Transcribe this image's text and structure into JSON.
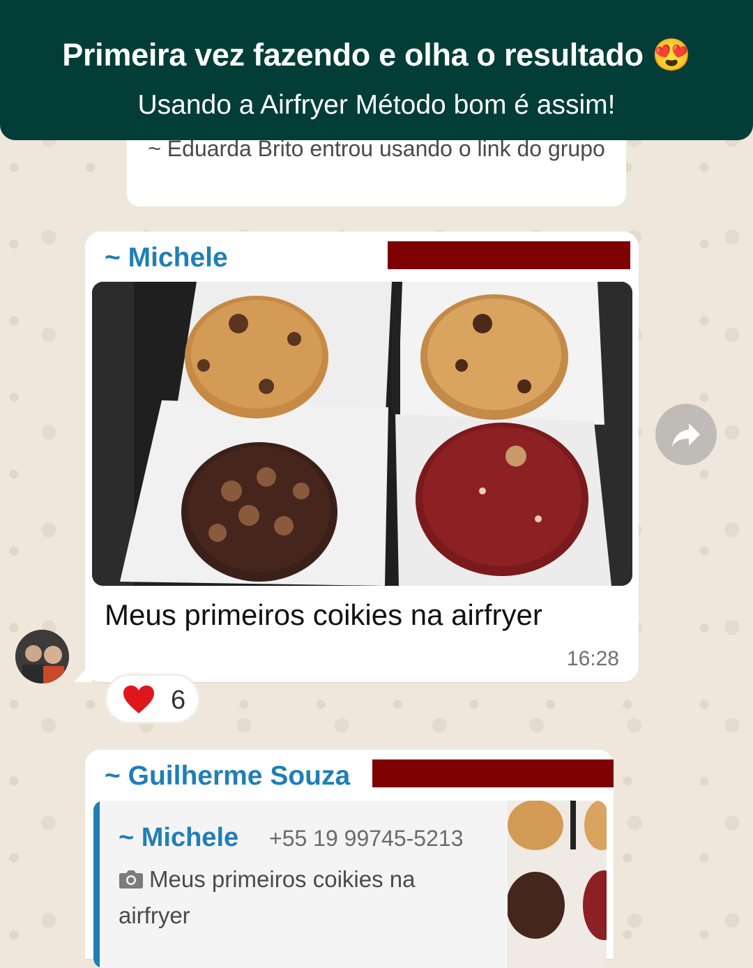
{
  "banner": {
    "title": "Primeira vez fazendo e olha o resultado 😍",
    "subtitle": "Usando a Airfryer Método bom é assim!"
  },
  "system_message": "~ Eduarda Brito entrou usando o link do grupo",
  "message1": {
    "sender": "~ Michele",
    "caption": "Meus primeiros coikies na airfryer",
    "time": "16:28",
    "reaction_emoji": "❤️",
    "reaction_count": "6"
  },
  "message2": {
    "sender": "~ Guilherme Souza",
    "quoted": {
      "sender": "~ Michele",
      "phone": "+55 19 99745-5213",
      "text": "Meus primeiros coikies na airfryer"
    }
  },
  "colors": {
    "banner": "#033d37",
    "sender": "#1f7fb6",
    "redaction": "#7e0000",
    "background": "#efe7dc"
  },
  "icons": [
    "forward-icon",
    "camera-icon",
    "heart-icon",
    "smiling-face-heart-eyes-emoji"
  ]
}
